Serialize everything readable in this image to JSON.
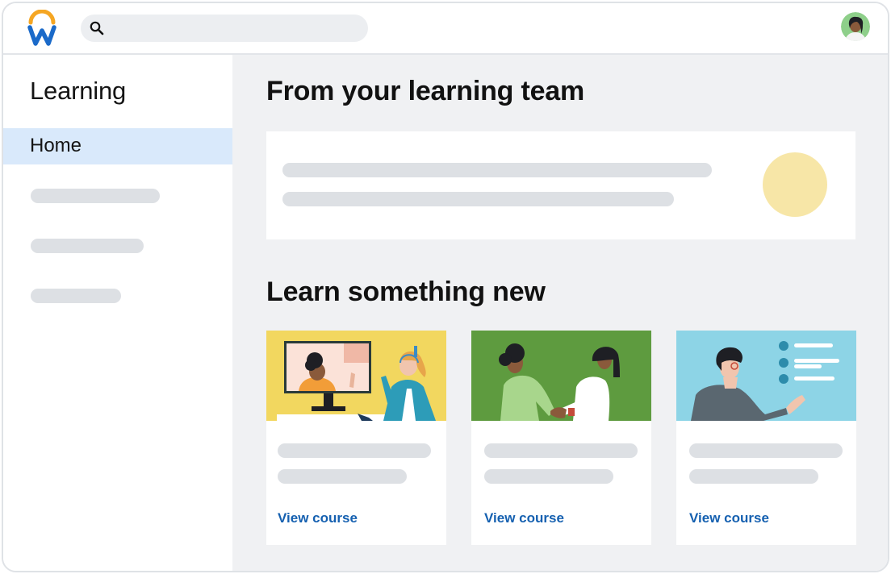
{
  "app": {
    "logo_icon": "workday-logo",
    "search": {
      "placeholder": "",
      "icon": "search-icon"
    },
    "avatar_icon": "user-avatar"
  },
  "sidebar": {
    "title": "Learning",
    "items": [
      {
        "label": "Home",
        "active": true
      }
    ]
  },
  "main": {
    "section_team": {
      "heading": "From your learning team"
    },
    "section_new": {
      "heading": "Learn something new",
      "courses": [
        {
          "image": "video-call-illustration",
          "link_label": "View course"
        },
        {
          "image": "handshake-illustration",
          "link_label": "View course"
        },
        {
          "image": "presenter-illustration",
          "link_label": "View course"
        }
      ]
    }
  },
  "colors": {
    "accent": "#1560b0",
    "active_nav": "#d9e9fb",
    "skeleton": "#dde0e4",
    "main_bg": "#f0f1f3"
  }
}
